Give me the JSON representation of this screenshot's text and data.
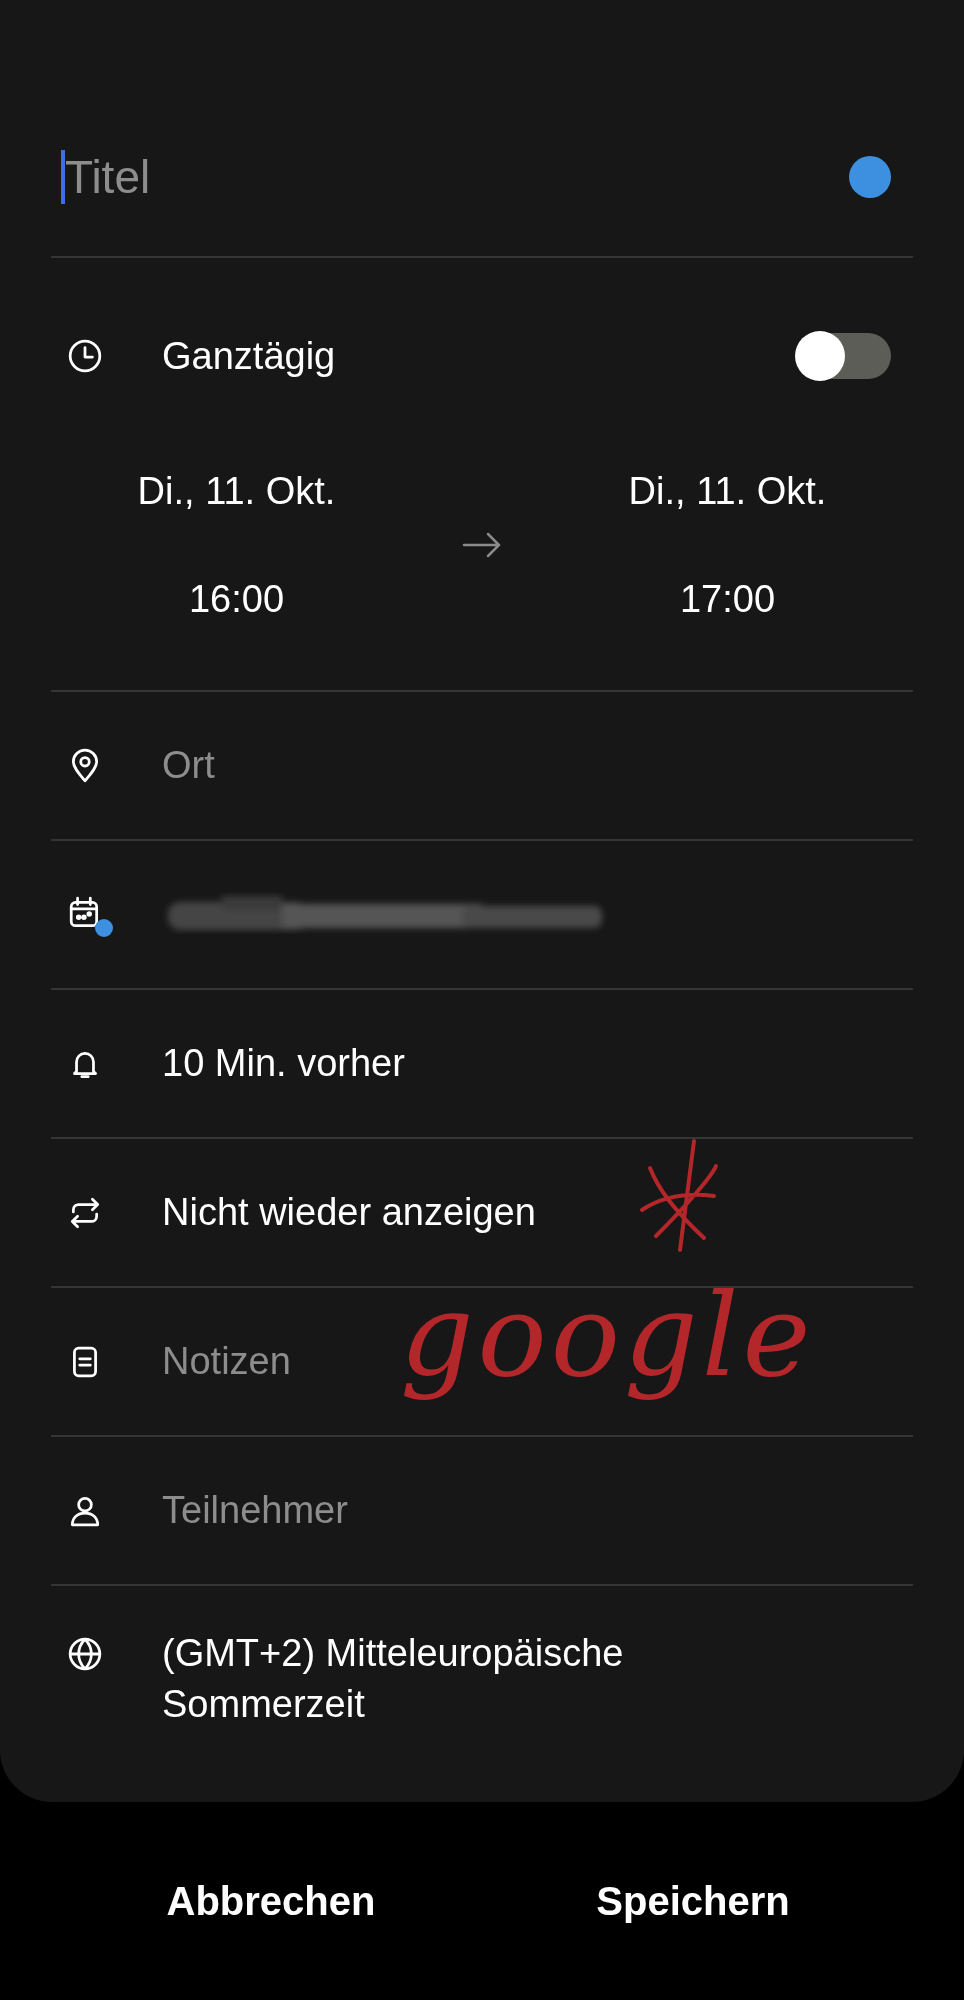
{
  "title_field": {
    "placeholder": "Titel",
    "focused": true,
    "color": "#3d8fe0"
  },
  "all_day": {
    "label": "Ganztägig",
    "on": false
  },
  "start": {
    "date": "Di., 11. Okt.",
    "time": "16:00"
  },
  "end": {
    "date": "Di., 11. Okt.",
    "time": "17:00"
  },
  "rows": [
    {
      "kind": "location",
      "placeholder": "Ort"
    },
    {
      "kind": "calendar",
      "color": "#3d8fe0"
    },
    {
      "kind": "reminder",
      "value": "10 Min. vorher"
    },
    {
      "kind": "repeat",
      "value": "Nicht wieder anzeigen"
    },
    {
      "kind": "notes",
      "placeholder": "Notizen"
    },
    {
      "kind": "participants",
      "placeholder": "Teilnehmer"
    },
    {
      "kind": "timezone",
      "value": "(GMT+2) Mitteleuropäische Sommerzeit"
    }
  ],
  "annotation": {
    "kind": "handwriting",
    "text": "google"
  },
  "buttons": [
    "Abbrechen",
    "Speichern"
  ]
}
